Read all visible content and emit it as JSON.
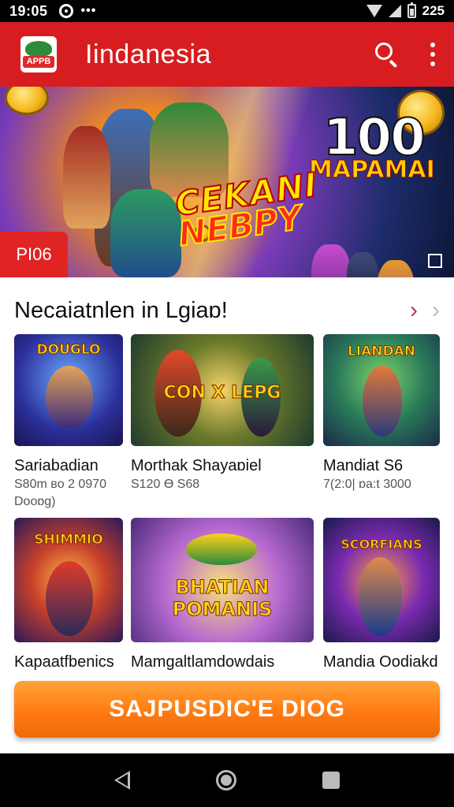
{
  "status_bar": {
    "time": "19:05",
    "battery_text": "225"
  },
  "app_bar": {
    "title": "Iindanesia",
    "logo_text": "APPB"
  },
  "banner": {
    "title_line1": "CEKANI",
    "title_line2": "NEBPY",
    "number": "100",
    "subtitle": "MAPAMAI",
    "tag": "PI06"
  },
  "section": {
    "title": "Necaiatnlen in Lgiaɒ!"
  },
  "games": [
    {
      "title": "Sariabadian",
      "meta1": "S80m ʙo 2 0970",
      "meta2": "Dooɒg)",
      "thumb_text": "DOUGLO"
    },
    {
      "title": "Morthak Shayaɒiel",
      "meta1": "S120 Ө S68",
      "meta2": "",
      "thumb_text": "CON X LEPG"
    },
    {
      "title": "Mandiat S6",
      "meta1": "7(2:0| ɒa:t 3000",
      "meta2": "",
      "thumb_text": "LIANDAN"
    },
    {
      "title": "Kapaatfbenics",
      "meta1": "",
      "meta2": "",
      "thumb_text": "SHIMMIO"
    },
    {
      "title": "Mamgaltlamdowdais",
      "meta1": "",
      "meta2": "",
      "thumb_text": "BHATIAN POMANIS"
    },
    {
      "title": "Mandia Oodiakd",
      "meta1": "",
      "meta2": "",
      "thumb_text": "SCORFIANS"
    }
  ],
  "cta": {
    "label": "SAJPUSDIC'E DIOG"
  },
  "colors": {
    "app_bar": "#d81d20",
    "cta": "#ff7a12",
    "accent_arrow": "#c0395a"
  }
}
